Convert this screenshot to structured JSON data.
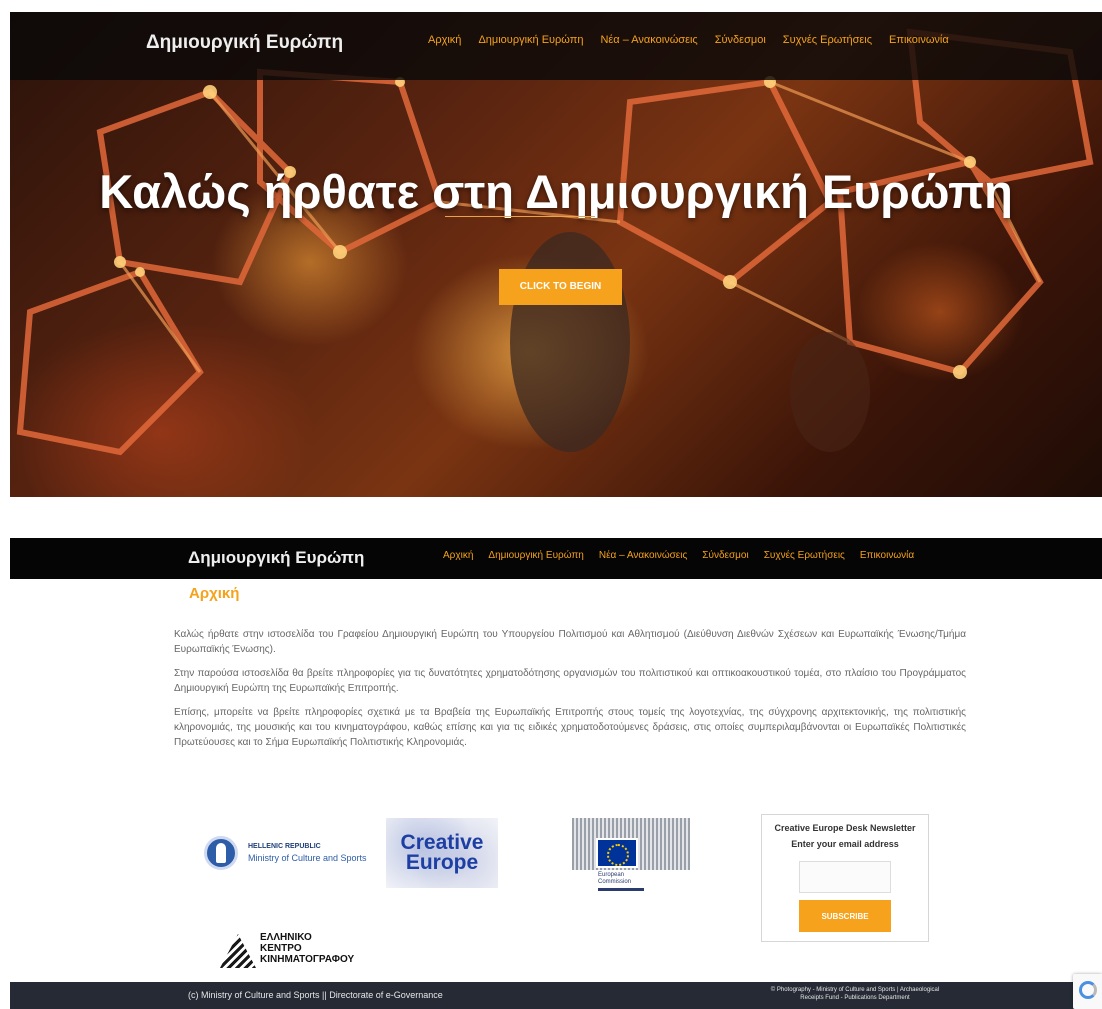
{
  "brand": "Δημιουργική Ευρώπη",
  "nav": {
    "items": [
      "Αρχική",
      "Δημιουργική Ευρώπη",
      "Νέα – Ανακοινώσεις",
      "Σύνδεσμοι",
      "Συχνές Ερωτήσεις",
      "Επικοινωνία"
    ]
  },
  "hero": {
    "title": "Καλώς ήρθατε στη Δημιουργική Ευρώπη",
    "cta_label": "CLICK TO BEGIN"
  },
  "page": {
    "heading": "Αρχική",
    "paragraphs": [
      "Καλώς ήρθατε στην ιστοσελίδα του Γραφείου Δημιουργική Ευρώπη του Υπουργείου Πολιτισμού και Αθλητισμού (Διεύθυνση Διεθνών Σχέσεων και Ευρωπαϊκής Ένωσης/Τμήμα Ευρωπαϊκής Ένωσης).",
      "Στην παρούσα ιστοσελίδα θα βρείτε πληροφορίες για τις δυνατότητες χρηματοδότησης οργανισμών του πολιτιστικού και οπτικοακουστικού τομέα, στο πλαίσιο του Προγράμματος Δημιουργική Ευρώπη της Ευρωπαϊκής Επιτροπής.",
      "Επίσης, μπορείτε να βρείτε πληροφορίες σχετικά με τα Βραβεία της Ευρωπαϊκής Επιτροπής στους τομείς της λογοτεχνίας, της σύγχρονης αρχιτεκτονικής, της πολιτιστικής κληρονομιάς, της μουσικής και του κινηματογράφου, καθώς επίσης και για τις ειδικές χρηματοδοτούμενες δράσεις, στις οποίες συμπεριλαμβάνονται οι Ευρωπαϊκές Πολιτιστικές Πρωτεύουσες και το Σήμα Ευρωπαϊκής Πολιτιστικής Κληρονομιάς."
    ]
  },
  "logos": {
    "hellenic": {
      "line1": "HELLENIC REPUBLIC",
      "line2": "Ministry of Culture and Sports"
    },
    "creative_europe": {
      "line1": "Creative",
      "line2": "Europe"
    },
    "european_commission": {
      "line1": "European",
      "line2": "Commission",
      "flag_color": "#003399"
    },
    "greek_film_centre": {
      "line1": "ΕΛΛΗΝΙΚΟ",
      "line2": "ΚΕΝΤΡΟ",
      "line3": "ΚΙΝΗΜΑΤΟΓΡΑΦΟΥ"
    }
  },
  "newsletter": {
    "title": "Creative Europe Desk Newsletter",
    "subtitle": "Enter your email address",
    "input_value": "",
    "button_label": "SUBSCRIBE"
  },
  "footer": {
    "left": "(c) Ministry of Culture and Sports || Directorate of e-Governance",
    "right_line1": "© Photography - Ministry of Culture and Sports | Archaeological",
    "right_line2": "Receipts Fund - Publications Department"
  },
  "colors": {
    "accent": "#f5a21c",
    "nav_bg": "#050505",
    "footer_bg": "#252a35"
  },
  "icons": {
    "recaptcha": "recaptcha-icon"
  }
}
